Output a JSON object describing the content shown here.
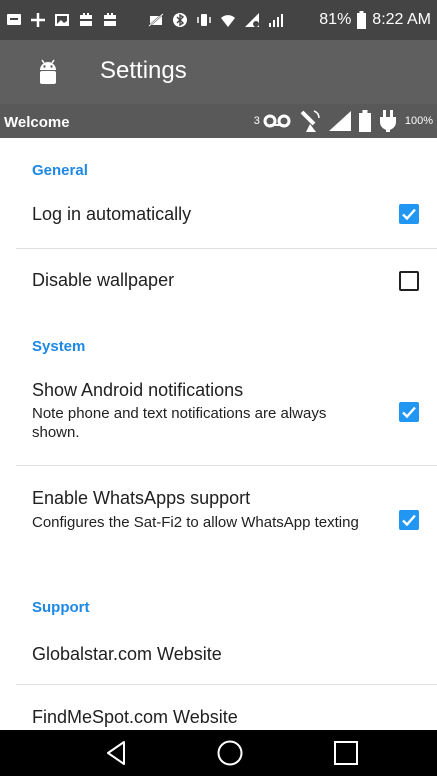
{
  "status_bar": {
    "battery_percent": "81%",
    "time": "8:22 AM",
    "icons": [
      "message-icon",
      "plus-icon",
      "image-icon",
      "app-icon",
      "app-icon",
      "no-sim-icon",
      "bluetooth-icon",
      "vibrate-icon",
      "wifi-icon",
      "no-signal-icon",
      "signal-icon",
      "battery-icon"
    ]
  },
  "app_bar": {
    "title": "Settings",
    "logo_icon": "android-icon"
  },
  "welcome_bar": {
    "label": "Welcome",
    "voicemail_count": "3",
    "battery_percent": "100%",
    "icons": [
      "voicemail-icon",
      "satellite-icon",
      "signal-icon",
      "battery-icon",
      "power-plug-icon"
    ]
  },
  "sections": {
    "general": "General",
    "system": "System",
    "support": "Support"
  },
  "settings": {
    "log_in_auto": {
      "title": "Log in automatically",
      "checked": true
    },
    "disable_wallpaper": {
      "title": "Disable wallpaper",
      "checked": false
    },
    "show_android_notifications": {
      "title": "Show Android notifications",
      "summary": "Note phone and text notifications are always shown.",
      "checked": true
    },
    "enable_whatsapp": {
      "title": "Enable WhatsApps support",
      "summary": "Configures the Sat-Fi2 to allow WhatsApp texting",
      "checked": true
    },
    "globalstar_website": {
      "title": "Globalstar.com Website"
    },
    "findmespot_website": {
      "title": "FindMeSpot.com Website"
    }
  },
  "colors": {
    "accent": "#2196f3",
    "section_header": "#1e88e5",
    "app_bar": "#5f5f5f",
    "status_bar": "#444444"
  },
  "nav_bar": {
    "icons": [
      "back-icon",
      "home-icon",
      "recents-icon"
    ]
  }
}
